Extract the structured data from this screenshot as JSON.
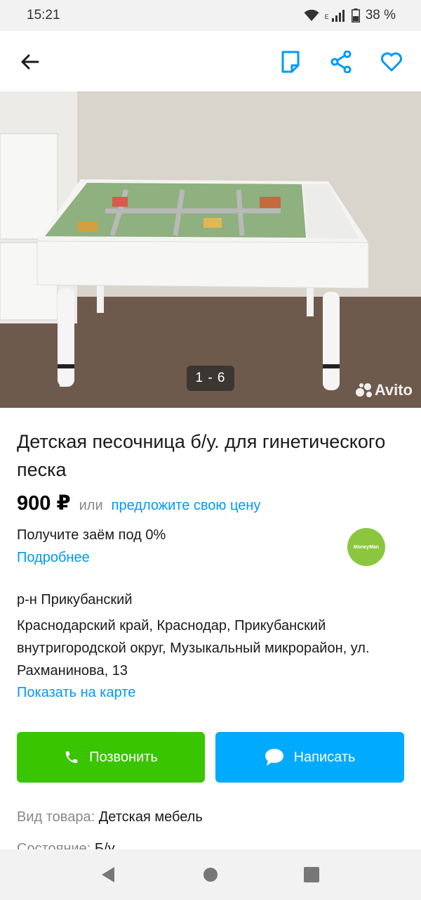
{
  "status_bar": {
    "time": "15:21",
    "network": "E",
    "battery": "38 %"
  },
  "icons": {
    "back": "arrow-left-icon",
    "note": "note-icon",
    "share": "share-icon",
    "favorite": "heart-icon",
    "phone": "phone-icon",
    "message": "chat-bubble-icon"
  },
  "colors": {
    "accent_blue": "#0099f7",
    "call_green": "#39c500",
    "message_blue": "#00aaff",
    "moneyman_green": "#8cc63f"
  },
  "gallery": {
    "counter": "1 - 6",
    "watermark": "Avito"
  },
  "listing": {
    "title": "Детская песочница б/у. для гинетического песка",
    "price": "900 ₽",
    "price_or": "или",
    "offer_link": "предложите свою цену"
  },
  "loan": {
    "text": "Получите заём под 0%",
    "more_link": "Подробнее",
    "logo_text": "MoneyMan"
  },
  "location": {
    "district": "р-н Прикубанский",
    "address": "Краснодарский край, Краснодар, Прикубанский внутригородской округ, Музыкальный микрорайон, ул. Рахманинова, 13",
    "map_link": "Показать на карте"
  },
  "actions": {
    "call_label": "Позвонить",
    "message_label": "Написать"
  },
  "params": [
    {
      "key": "Вид товара:",
      "value": "Детская мебель"
    },
    {
      "key": "Состояние:",
      "value": "Б/у"
    }
  ]
}
